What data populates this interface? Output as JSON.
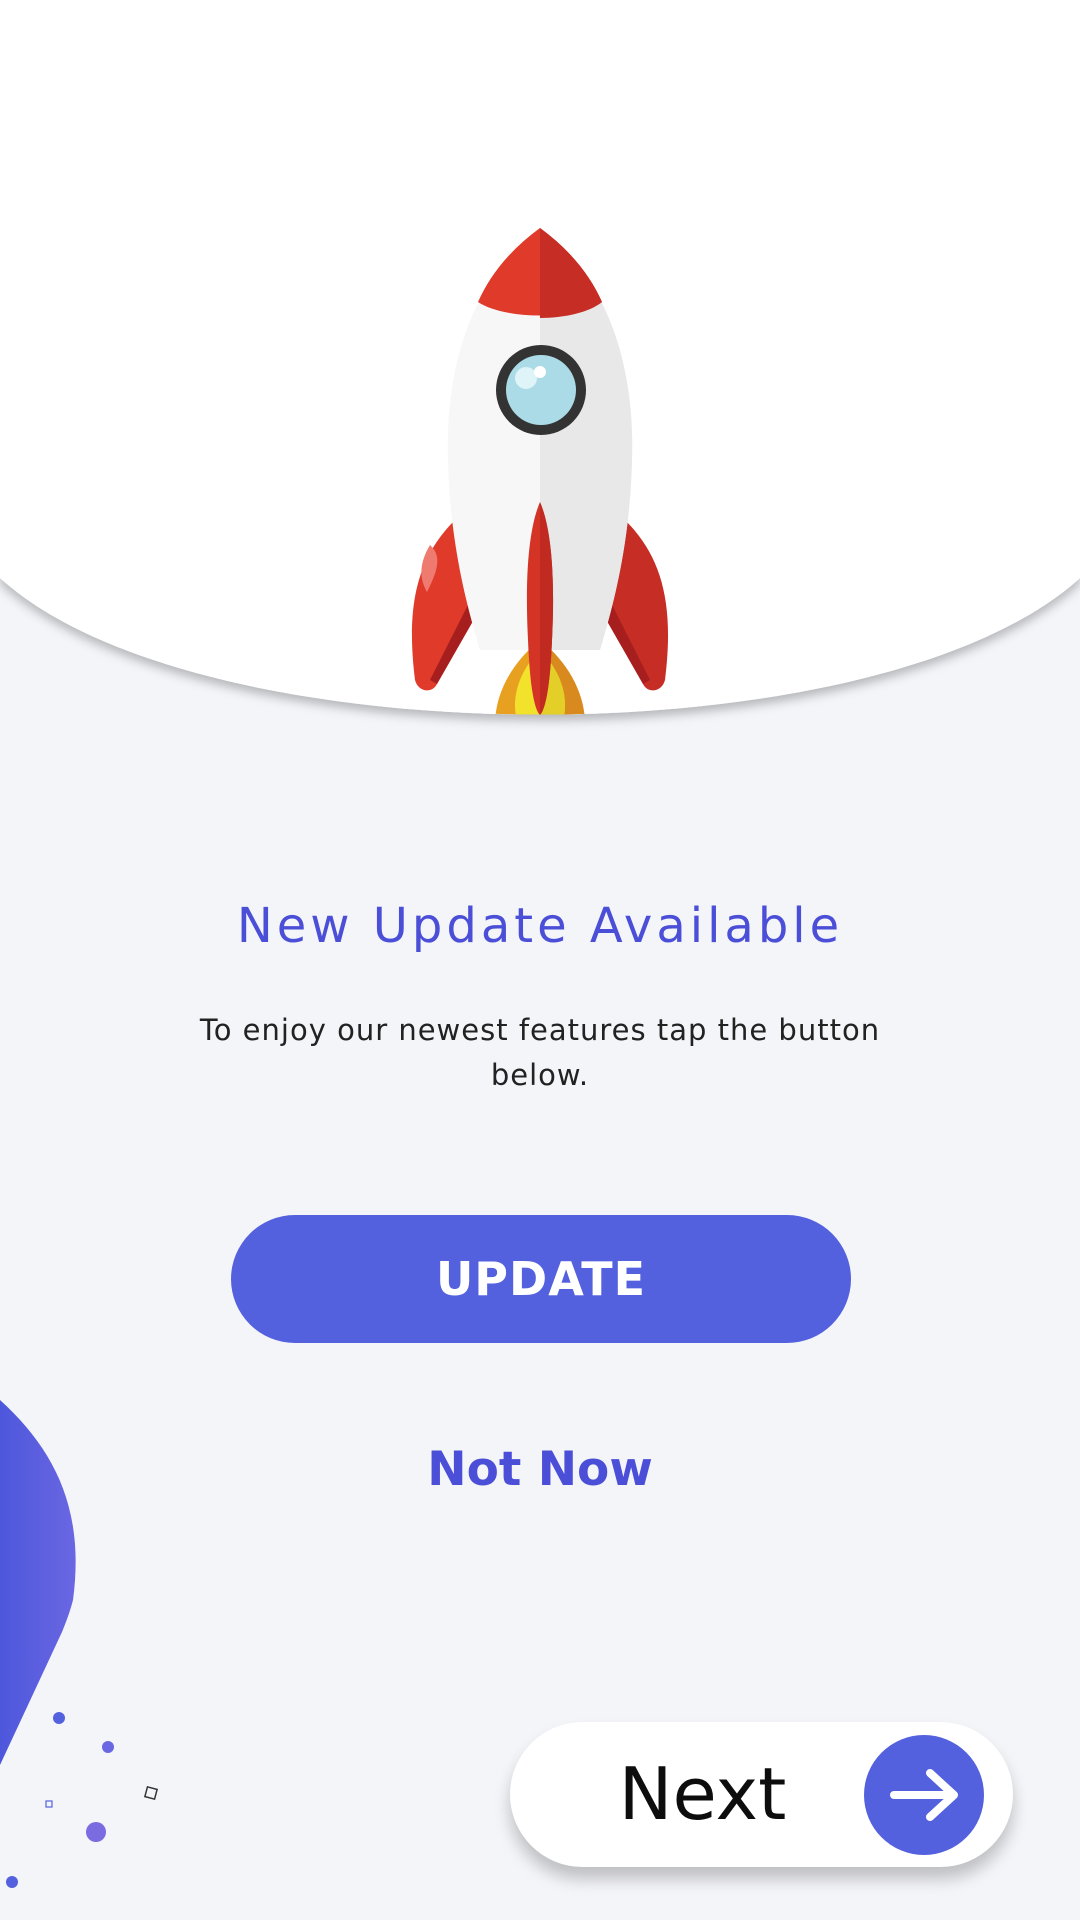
{
  "hero": {
    "illustration": "rocket-icon"
  },
  "title": "New Update Available",
  "subtitle": "To enjoy our newest features tap the button below.",
  "buttons": {
    "update_label": "UPDATE",
    "not_now_label": "Not Now",
    "next_label": "Next"
  },
  "icons": {
    "next": "arrow-right-icon"
  },
  "colors": {
    "accent": "#5461de",
    "title": "#4b4fd8",
    "background": "#f4f5f9"
  }
}
